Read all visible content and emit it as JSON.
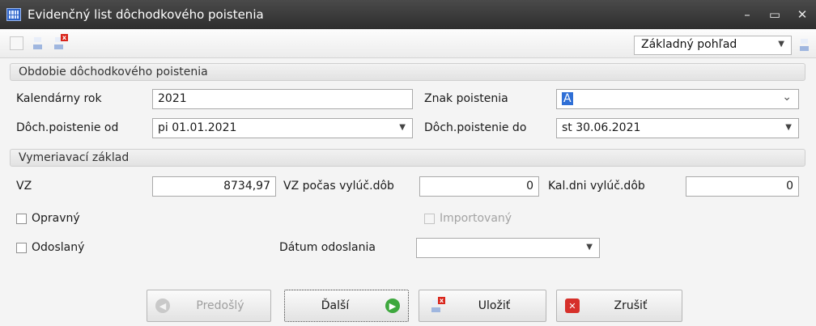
{
  "window": {
    "title": "Evidenčný list dôchodkového poistenia",
    "minimize": "–",
    "maximize": "▭",
    "close": "✕"
  },
  "toolbar": {
    "view": "Základný pohľad"
  },
  "section1": {
    "title": "Obdobie dôchodkového poistenia",
    "year_label": "Kalendárny rok",
    "year_value": "2021",
    "sign_label": "Znak poistenia",
    "sign_value": "A",
    "from_label": "Dôch.poistenie od",
    "from_value": "pi 01.01.2021",
    "to_label": "Dôch.poistenie do",
    "to_value": "st 30.06.2021"
  },
  "section2": {
    "title": "Vymeriavací základ",
    "vz_label": "VZ",
    "vz_value": "8734,97",
    "vz_excl_label": "VZ počas vylúč.dôb",
    "vz_excl_value": "0",
    "days_label": "Kal.dni vylúč.dôb",
    "days_value": "0"
  },
  "flags": {
    "corrective": "Opravný",
    "imported": "Importovaný",
    "sent": "Odoslaný",
    "sent_date_label": "Dátum odoslania",
    "sent_date_value": ""
  },
  "buttons": {
    "prev": "Predošlý",
    "next": "Ďalší",
    "save": "Uložiť",
    "cancel": "Zrušiť"
  }
}
